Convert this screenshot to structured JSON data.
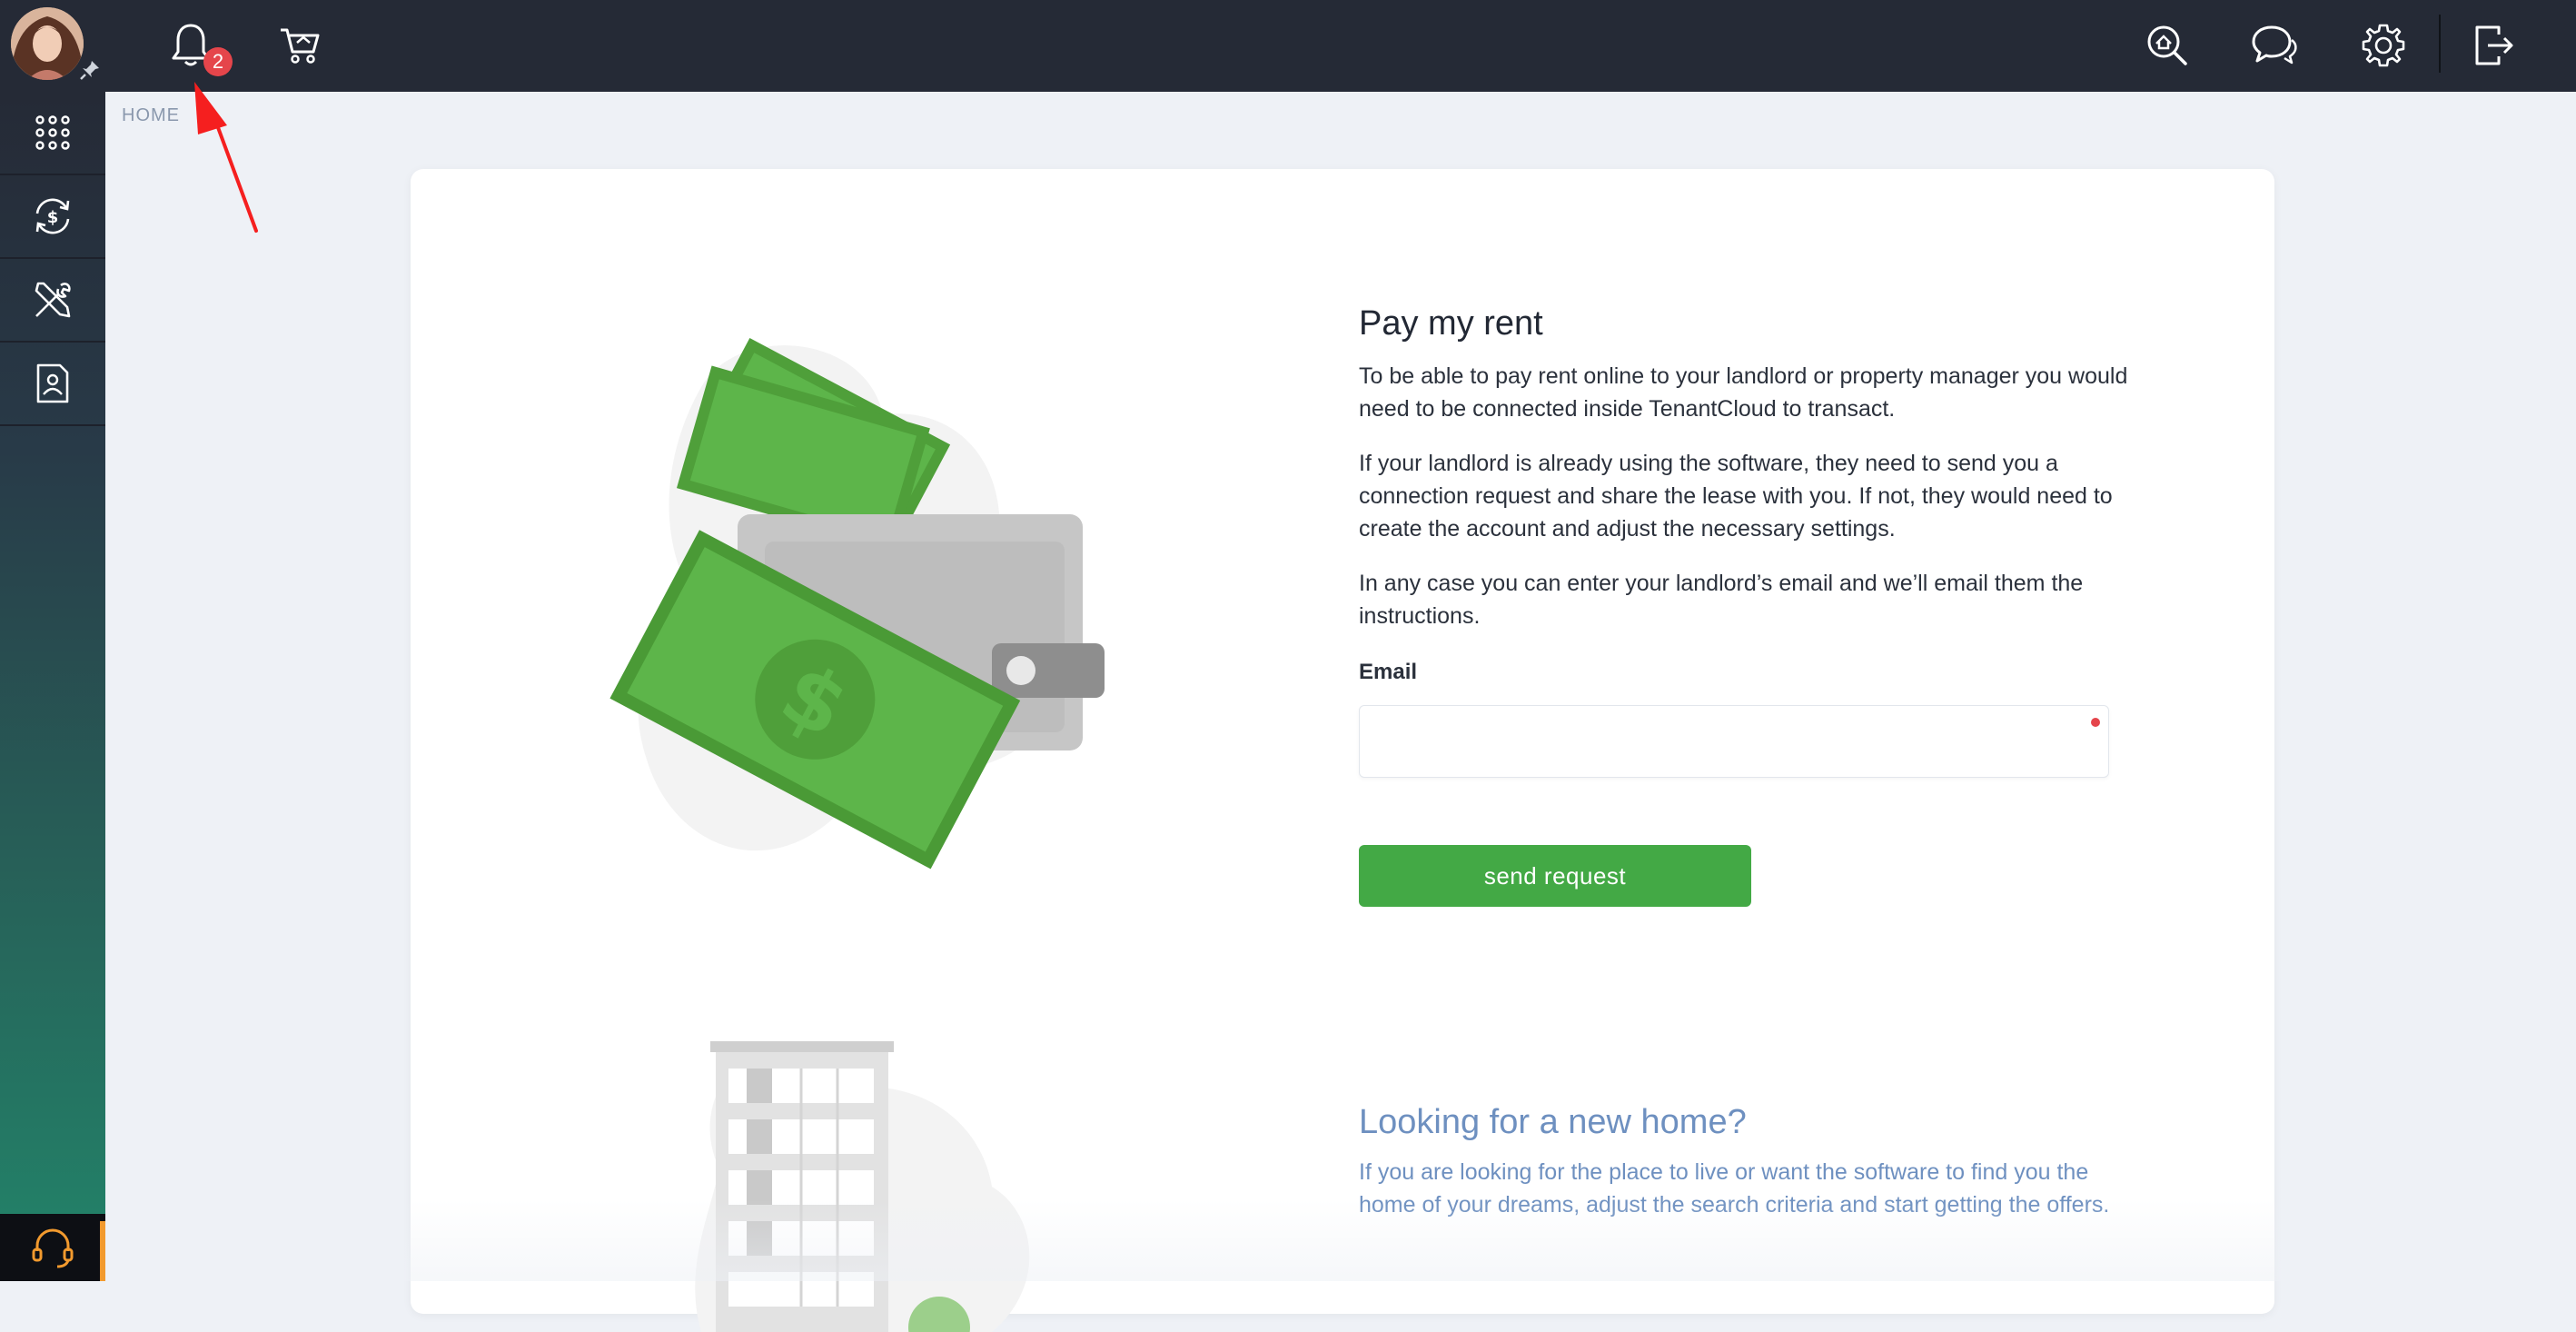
{
  "topbar": {
    "notification_count": "2",
    "icons": [
      "bell-icon",
      "cart-icon",
      "search-property-icon",
      "chat-icon",
      "gear-icon",
      "logout-icon"
    ]
  },
  "sidebar": {
    "items": [
      {
        "icon": "apps-grid-icon"
      },
      {
        "icon": "money-cycle-icon"
      },
      {
        "icon": "tools-icon"
      },
      {
        "icon": "tenant-document-icon"
      }
    ],
    "support_icon": "headset-icon"
  },
  "breadcrumb": {
    "home": "HOME"
  },
  "pay_rent": {
    "title": "Pay my rent",
    "p1": "To be able to pay rent online to your landlord or property manager you would need to be connected inside TenantCloud to transact.",
    "p2": "If your landlord is already using the software, they need to send you a connection request and share the lease with you. If not, they would need to create the account and adjust the necessary settings.",
    "p3": "In any case you can enter your landlord’s email and we’ll email them the instructions.",
    "email_label": "Email",
    "email_value": "",
    "button": "send request"
  },
  "new_home": {
    "title": "Looking for a new home?",
    "text": "If you are looking for the place to live or want the software to find you the home of your dreams, adjust the search criteria and start getting the offers."
  },
  "colors": {
    "topbar": "#252a36",
    "accent_green": "#43a945",
    "badge_red": "#e5454b",
    "link_blue": "#6e90c0"
  }
}
